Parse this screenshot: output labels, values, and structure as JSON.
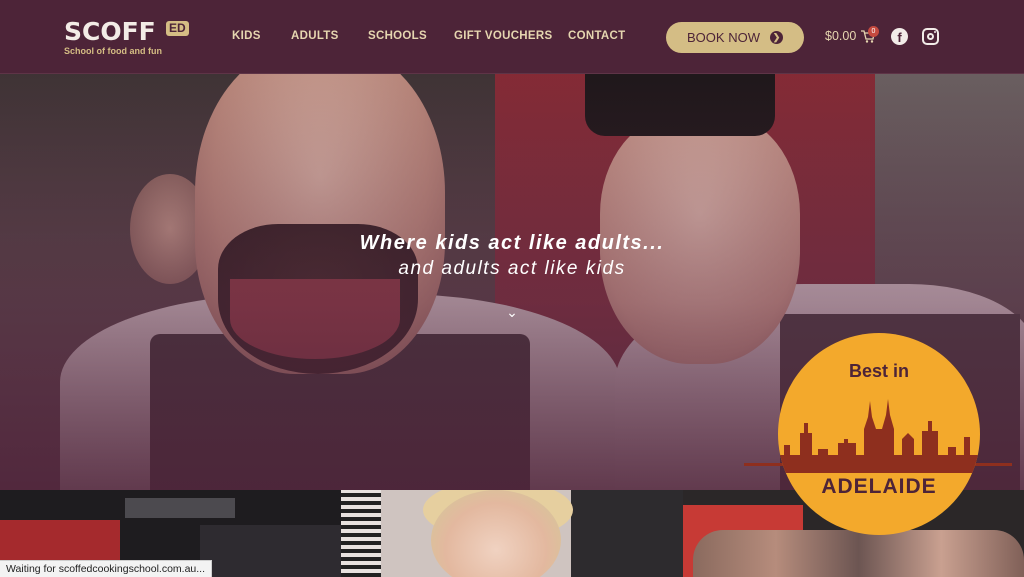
{
  "header": {
    "logo_main": "SCOFF",
    "logo_ed": "ED",
    "logo_tagline": "School of food and fun",
    "nav": [
      {
        "label": "KIDS"
      },
      {
        "label": "ADULTS"
      },
      {
        "label": "SCHOOLS"
      },
      {
        "label": "GIFT VOUCHERS"
      },
      {
        "label": "CONTACT"
      }
    ],
    "book_now": "BOOK NOW",
    "cart_total": "$0.00",
    "cart_count": "0"
  },
  "hero": {
    "line1": "Where kids act like adults...",
    "line2": "and adults act like kids",
    "scroll_icon": "chevron-down-icon"
  },
  "badge": {
    "title": "Best in",
    "label": "ADELAIDE"
  },
  "status_bar": {
    "text": "Waiting for scoffedcookingschool.com.au..."
  },
  "colors": {
    "header_bg": "#4d2438",
    "accent": "#d4bd85",
    "badge": "#f3a92c"
  }
}
